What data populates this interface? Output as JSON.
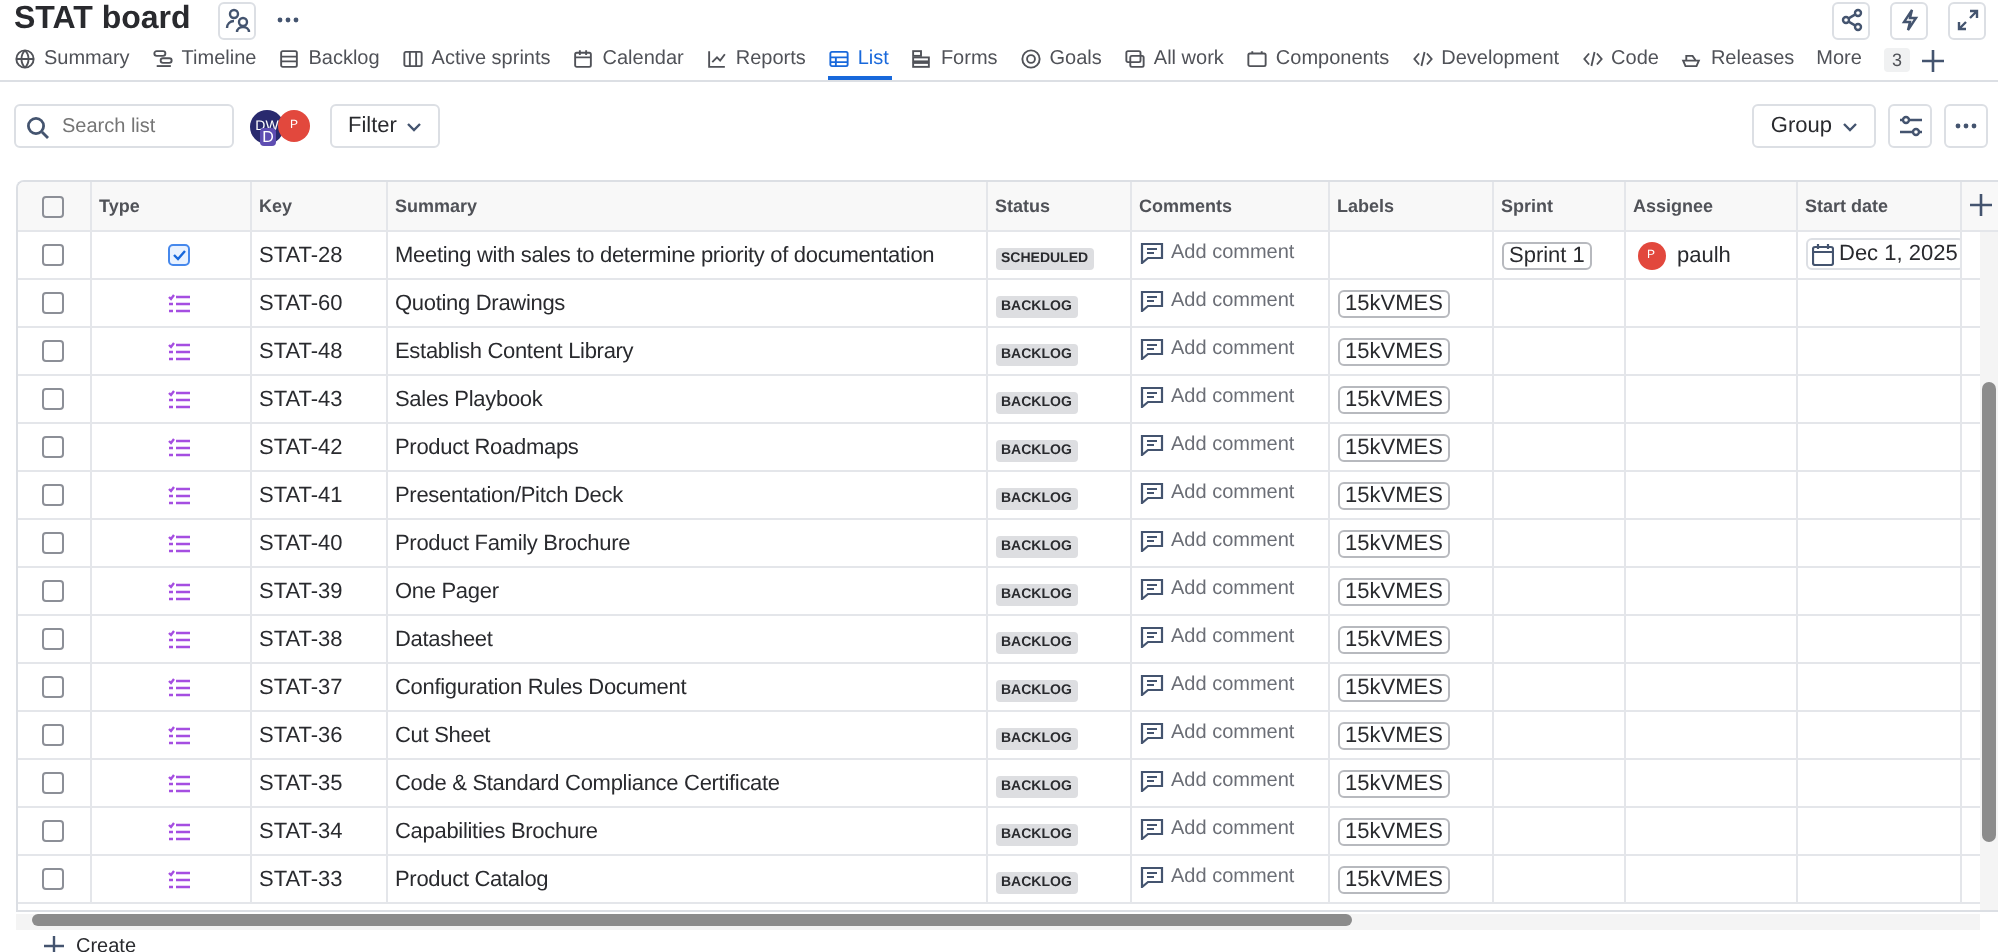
{
  "title": "STAT board",
  "tabs": [
    {
      "label": "Summary",
      "selected": false
    },
    {
      "label": "Timeline",
      "selected": false
    },
    {
      "label": "Backlog",
      "selected": false
    },
    {
      "label": "Active sprints",
      "selected": false
    },
    {
      "label": "Calendar",
      "selected": false
    },
    {
      "label": "Reports",
      "selected": false
    },
    {
      "label": "List",
      "selected": true
    },
    {
      "label": "Forms",
      "selected": false
    },
    {
      "label": "Goals",
      "selected": false
    },
    {
      "label": "All work",
      "selected": false
    },
    {
      "label": "Components",
      "selected": false
    },
    {
      "label": "Development",
      "selected": false
    },
    {
      "label": "Code",
      "selected": false
    },
    {
      "label": "Releases",
      "selected": false
    }
  ],
  "more": {
    "label": "More",
    "count": "3"
  },
  "toolbar": {
    "search_placeholder": "Search list",
    "avatars": [
      "DW",
      "D",
      "P"
    ],
    "filter": "Filter",
    "group": "Group"
  },
  "table": {
    "select_all_checked": false,
    "columns": [
      "Type",
      "Key",
      "Summary",
      "Status",
      "Comments",
      "Labels",
      "Sprint",
      "Assignee",
      "Start date"
    ],
    "rows": [
      {
        "checked": false,
        "kind": "task",
        "key": "STAT-28",
        "summary": "Meeting with sales to determine priority of documentation",
        "status": "SCHEDULED",
        "comment": "Add comment",
        "sprint": "Sprint 1",
        "assignee": {
          "initial": "P",
          "name": "paulh"
        },
        "start_date": "Dec 1, 2025"
      },
      {
        "checked": false,
        "kind": "subtasks",
        "key": "STAT-60",
        "summary": "Quoting Drawings",
        "status": "BACKLOG",
        "comment": "Add comment",
        "label": "15kVMES"
      },
      {
        "checked": false,
        "kind": "subtasks",
        "key": "STAT-48",
        "summary": "Establish Content Library",
        "status": "BACKLOG",
        "comment": "Add comment",
        "label": "15kVMES"
      },
      {
        "checked": false,
        "kind": "subtasks",
        "key": "STAT-43",
        "summary": "Sales Playbook",
        "status": "BACKLOG",
        "comment": "Add comment",
        "label": "15kVMES"
      },
      {
        "checked": false,
        "kind": "subtasks",
        "key": "STAT-42",
        "summary": "Product Roadmaps",
        "status": "BACKLOG",
        "comment": "Add comment",
        "label": "15kVMES"
      },
      {
        "checked": false,
        "kind": "subtasks",
        "key": "STAT-41",
        "summary": "Presentation/Pitch Deck",
        "status": "BACKLOG",
        "comment": "Add comment",
        "label": "15kVMES"
      },
      {
        "checked": false,
        "kind": "subtasks",
        "key": "STAT-40",
        "summary": "Product Family Brochure",
        "status": "BACKLOG",
        "comment": "Add comment",
        "label": "15kVMES"
      },
      {
        "checked": false,
        "kind": "subtasks",
        "key": "STAT-39",
        "summary": "One Pager",
        "status": "BACKLOG",
        "comment": "Add comment",
        "label": "15kVMES"
      },
      {
        "checked": false,
        "kind": "subtasks",
        "key": "STAT-38",
        "summary": "Datasheet",
        "status": "BACKLOG",
        "comment": "Add comment",
        "label": "15kVMES"
      },
      {
        "checked": false,
        "kind": "subtasks",
        "key": "STAT-37",
        "summary": "Configuration Rules Document",
        "status": "BACKLOG",
        "comment": "Add comment",
        "label": "15kVMES"
      },
      {
        "checked": false,
        "kind": "subtasks",
        "key": "STAT-36",
        "summary": "Cut Sheet",
        "status": "BACKLOG",
        "comment": "Add comment",
        "label": "15kVMES"
      },
      {
        "checked": false,
        "kind": "subtasks",
        "key": "STAT-35",
        "summary": "Code & Standard Compliance Certificate",
        "status": "BACKLOG",
        "comment": "Add comment",
        "label": "15kVMES"
      },
      {
        "checked": false,
        "kind": "subtasks",
        "key": "STAT-34",
        "summary": "Capabilities Brochure",
        "status": "BACKLOG",
        "comment": "Add comment",
        "label": "15kVMES"
      },
      {
        "checked": false,
        "kind": "subtasks",
        "key": "STAT-33",
        "summary": "Product Catalog",
        "status": "BACKLOG",
        "comment": "Add comment",
        "label": "15kVMES"
      }
    ]
  },
  "create": "Create"
}
